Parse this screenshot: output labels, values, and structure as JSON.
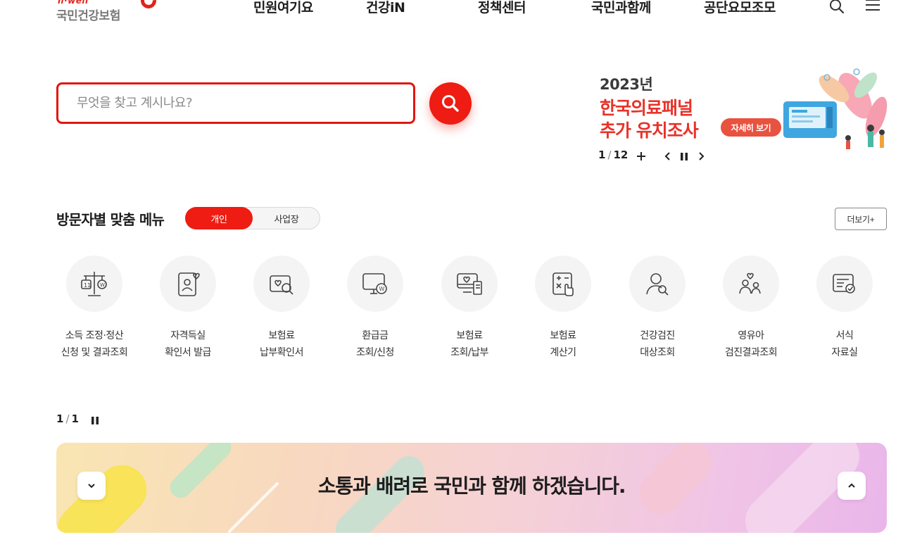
{
  "header": {
    "logo_tagline": "h·well",
    "logo_name": "국민건강보험",
    "nav": [
      "민원여기요",
      "건강iN",
      "정책센터",
      "국민과함께",
      "공단요모조모"
    ],
    "icons": [
      "search-icon",
      "menu-icon"
    ]
  },
  "search": {
    "placeholder": "무엇을 찾고 계시나요?",
    "value": ""
  },
  "banner": {
    "year": "2023년",
    "line1": "한국의료패널",
    "line2": "추가 유치조사",
    "cta": "자세히 보기",
    "current": "1",
    "total": "12"
  },
  "section": {
    "title": "방문자별 맞춤 메뉴",
    "toggle_selected": "개인",
    "toggle_other": "사업장",
    "more": "더보기+"
  },
  "menu": [
    {
      "line1": "소득 조정·정산",
      "line2": "신청 및 결과조회",
      "icon": "scale-icon"
    },
    {
      "line1": "자격득실",
      "line2": "확인서 발급",
      "icon": "person-certificate-icon"
    },
    {
      "line1": "보험료",
      "line2": "납부확인서",
      "icon": "document-search-icon"
    },
    {
      "line1": "환급금",
      "line2": "조회/신청",
      "icon": "monitor-refund-icon"
    },
    {
      "line1": "보험료",
      "line2": "조회/납부",
      "icon": "monitor-payment-icon"
    },
    {
      "line1": "보험료",
      "line2": "계산기",
      "icon": "calculator-icon"
    },
    {
      "line1": "건강검진",
      "line2": "대상조회",
      "icon": "person-search-icon"
    },
    {
      "line1": "영유아",
      "line2": "검진결과조회",
      "icon": "family-icon"
    },
    {
      "line1": "서식",
      "line2": "자료실",
      "icon": "form-document-icon"
    }
  ],
  "menu_pager": {
    "current": "1",
    "total": "1"
  },
  "slogan": {
    "text": "소통과 배려로 국민과 함께 하겠습니다."
  },
  "colors": {
    "accent": "#ee1c12",
    "banner_red": "#e8322a"
  }
}
